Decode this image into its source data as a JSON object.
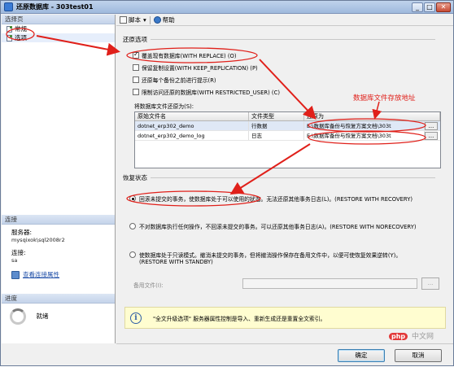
{
  "window": {
    "title": "还原数据库 - 303test01"
  },
  "left": {
    "select_page_header": "选择页",
    "pages": [
      {
        "label": "常规"
      },
      {
        "label": "选项"
      }
    ],
    "connection_header": "连接",
    "server_label": "服务器:",
    "server_value": "mysqixok\\sql2008r2",
    "conn_label": "连接:",
    "conn_value": "sa",
    "view_props_link": "查看连接属性",
    "progress_header": "进度",
    "progress_status": "就绪"
  },
  "toolbar": {
    "script_label": "脚本",
    "help_label": "帮助"
  },
  "restore_options": {
    "header": "还原选项",
    "options": [
      {
        "label": "覆盖现有数据库(WITH REPLACE) (O)",
        "checked": true
      },
      {
        "label": "保留复制设置(WITH KEEP_REPLICATION) (P)",
        "checked": false
      },
      {
        "label": "还原每个备份之前进行提示(R)",
        "checked": false
      },
      {
        "label": "限制访问还原的数据库(WITH RESTRICTED_USER) (C)",
        "checked": false
      }
    ],
    "restore_as_label": "将数据库文件还原为(S):"
  },
  "files_table": {
    "headers": [
      "原始文件名",
      "文件类型",
      "还原为"
    ],
    "rows": [
      {
        "name": "dotnet_erp302_demo",
        "type": "行数据",
        "restore_as": "E:\\数据库备份与恢复方案文档\\303t"
      },
      {
        "name": "dotnet_erp302_demo_log",
        "type": "日志",
        "restore_as": "E:\\数据库备份与恢复方案文档\\303t"
      }
    ],
    "browse_label": "..."
  },
  "recovery": {
    "header": "恢复状态",
    "options": [
      {
        "label": "回滚未提交的事务，使数据库处于可以使用的状态。无法还原其他事务日志(L)。(RESTORE WITH RECOVERY)",
        "selected": true
      },
      {
        "label": "不对数据库执行任何操作，不回滚未提交的事务。可以还原其他事务日志(A)。(RESTORE WITH NORECOVERY)",
        "selected": false
      },
      {
        "label1": "使数据库处于只读模式。撤消未提交的事务，但将撤消操作保存在备用文件中，以便可使恢复效果逆转(Y)。",
        "label2": "(RESTORE WITH STANDBY)",
        "selected": false
      }
    ],
    "standby_file_label": "备用文件(I):",
    "standby_browse": "..."
  },
  "info": {
    "text": "\"全文升级选项\" 服务器属性控制是导入、重新生成还是重置全文索引。"
  },
  "buttons": {
    "ok": "确定",
    "cancel": "取消"
  },
  "annotation": "数据库文件存放地址",
  "watermark": {
    "logo": "php",
    "text": "中文网"
  },
  "colors": {
    "annotation": "#e0201a",
    "title_bar": "#bfd3ec"
  }
}
